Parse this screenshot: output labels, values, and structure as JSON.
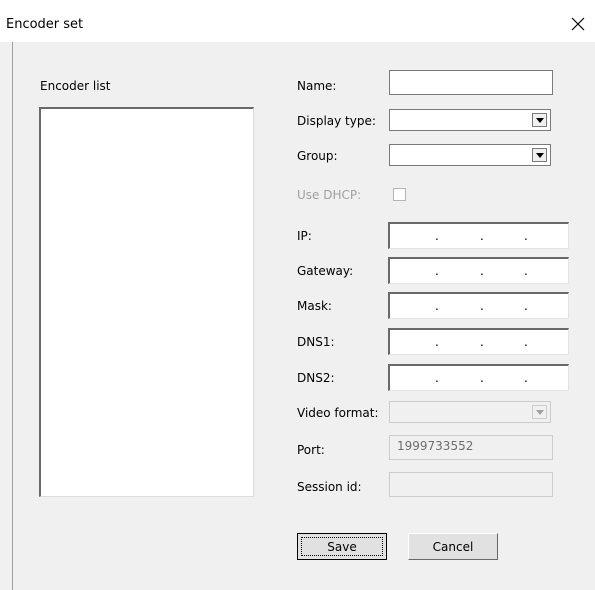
{
  "window": {
    "title": "Encoder set",
    "close_glyph": "✕"
  },
  "encoder_list": {
    "label": "Encoder list",
    "items": []
  },
  "form": {
    "name_label": "Name:",
    "name_value": "",
    "display_type_label": "Display type:",
    "display_type_value": "",
    "group_label": "Group:",
    "group_value": "",
    "use_dhcp_label": "Use DHCP:",
    "use_dhcp_checked": false,
    "ip_label": "IP:",
    "gateway_label": "Gateway:",
    "mask_label": "Mask:",
    "dns1_label": "DNS1:",
    "dns2_label": "DNS2:",
    "video_format_label": "Video format:",
    "video_format_value": "",
    "port_label": "Port:",
    "port_value": "1999733552",
    "session_id_label": "Session id:",
    "session_id_value": ""
  },
  "ip_separator": ".",
  "buttons": {
    "save_label": "Save",
    "cancel_label": "Cancel"
  },
  "icons": {
    "close": "close-icon",
    "dropdown": "chevron-down-icon",
    "checkbox": "checkbox-unchecked"
  },
  "colors": {
    "dialog_bg": "#f0f0f0",
    "titlebar_bg": "#ffffff",
    "disabled_text": "#a0a0a0"
  }
}
